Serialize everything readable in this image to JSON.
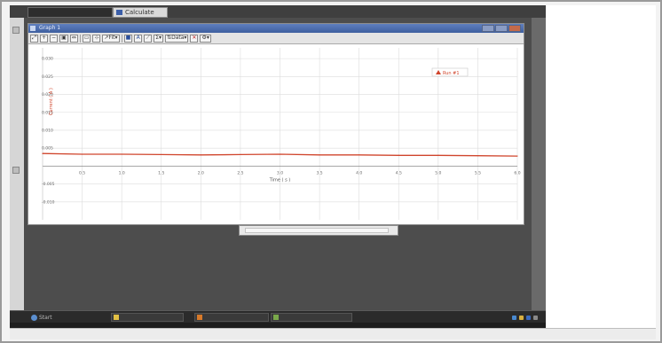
{
  "app": {
    "title": "Graph 1",
    "top_tab": "Calculate"
  },
  "toolbar": {
    "fit_label": "Fit",
    "sigma_label": "Σ",
    "data_label": "Data"
  },
  "chart_data": {
    "type": "line",
    "title": "",
    "xlabel": "Time ( s )",
    "ylabel": "Current ( A )",
    "xlim": [
      0,
      6.0
    ],
    "ylim": [
      -0.015,
      0.033
    ],
    "x_ticks": [
      "0.5",
      "1.0",
      "1.5",
      "2.0",
      "2.5",
      "3.0",
      "3.5",
      "4.0",
      "4.5",
      "5.0",
      "5.5",
      "6.0"
    ],
    "y_ticks": [
      "0.030",
      "0.025",
      "0.020",
      "0.015",
      "0.010",
      "0.005",
      "-0.005",
      "-0.010"
    ],
    "grid": true,
    "legend_position": "top-right",
    "series": [
      {
        "name": "Run #1",
        "color": "#d0452c",
        "x": [
          0.0,
          0.5,
          1.0,
          1.5,
          2.0,
          2.5,
          3.0,
          3.5,
          4.0,
          4.5,
          5.0,
          5.5,
          6.0
        ],
        "y": [
          0.0035,
          0.0033,
          0.0033,
          0.0032,
          0.0031,
          0.0032,
          0.0033,
          0.0031,
          0.0031,
          0.003,
          0.003,
          0.0029,
          0.0028
        ]
      }
    ]
  },
  "taskbar": {
    "start_label": "Start",
    "items": [
      "",
      "",
      "",
      ""
    ]
  }
}
